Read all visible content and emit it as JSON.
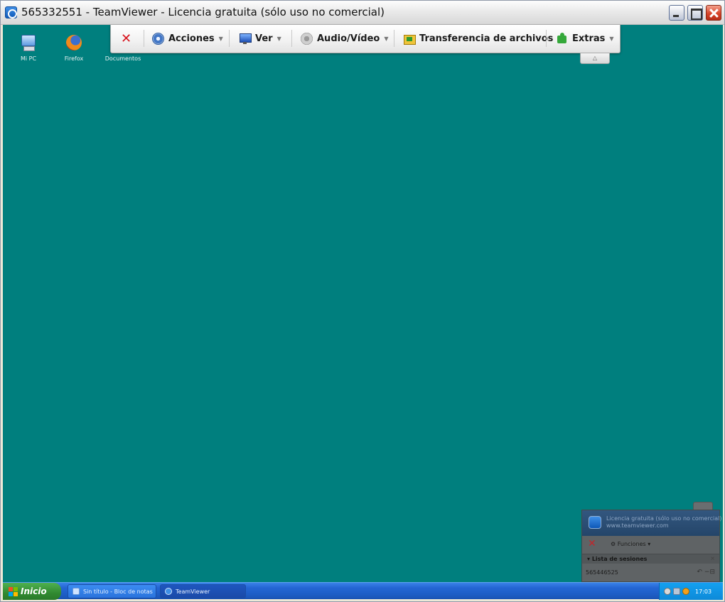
{
  "window": {
    "title": "565332551 - TeamViewer - Licencia gratuita (sólo uso no comercial)"
  },
  "desktop": {
    "background_color": "#007f7e",
    "icons": [
      {
        "label": "Mi PC",
        "icon": "computer-icon"
      },
      {
        "label": "Firefox",
        "icon": "firefox-icon"
      },
      {
        "label": "Documentos",
        "icon": "folder-icon"
      }
    ]
  },
  "toolbar": {
    "close_icon": "close-session-icon",
    "items": [
      {
        "label": "Acciones",
        "icon": "gear-icon",
        "has_dropdown": true
      },
      {
        "label": "Ver",
        "icon": "monitor-icon",
        "has_dropdown": true
      },
      {
        "label": "Audio/Vídeo",
        "icon": "speaker-icon",
        "has_dropdown": true
      },
      {
        "label": "Transferencia de archivos",
        "icon": "file-transfer-icon",
        "has_dropdown": false
      },
      {
        "label": "Extras",
        "icon": "puzzle-icon",
        "has_dropdown": true
      }
    ],
    "collapse_glyph": "△"
  },
  "control_panel": {
    "header_text": "Licencia gratuita (sólo uso no comercial)\nwww.teamviewer.com",
    "close_glyph": "✕",
    "functions_label": "Funciones",
    "session_list_label": "Lista de sesiones",
    "session_close": "×",
    "session_id": "565446525",
    "session_controls": "↶ −⊟"
  },
  "taskbar": {
    "start_label": "Inicio",
    "tasks": [
      {
        "label": "Sin título - Bloc de notas",
        "icon": "notepad-icon"
      },
      {
        "label": "TeamViewer",
        "icon": "teamviewer-icon"
      }
    ],
    "clock": "17:03"
  },
  "colors": {
    "desktop": "#007f7e",
    "close_red": "#d7131c",
    "taskbar_blue": "#2466d4",
    "start_green": "#318a31"
  }
}
